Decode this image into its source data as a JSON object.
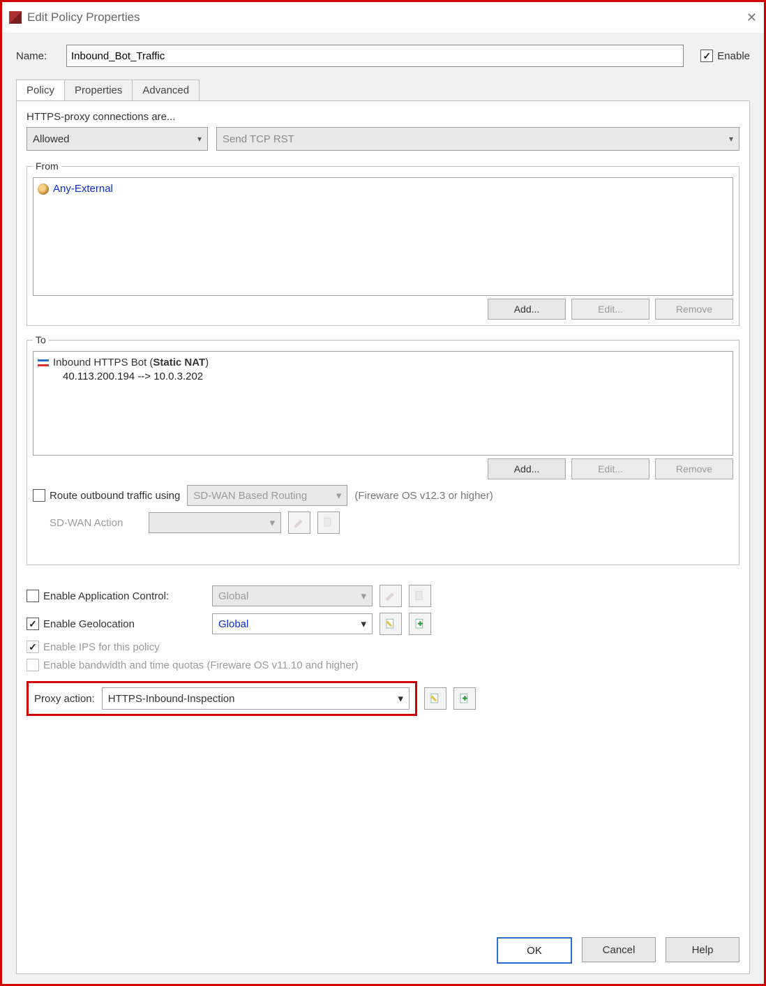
{
  "window": {
    "title": "Edit Policy Properties"
  },
  "name": {
    "label": "Name:",
    "value": "Inbound_Bot_Traffic"
  },
  "enable": {
    "label": "Enable",
    "checked": true
  },
  "tabs": {
    "policy": "Policy",
    "properties": "Properties",
    "advanced": "Advanced",
    "active": "policy"
  },
  "policy": {
    "connections_label": "HTTPS-proxy connections are...",
    "mode": "Allowed",
    "deny_action": "Send TCP RST",
    "from": {
      "legend": "From",
      "items": [
        {
          "text": "Any-External",
          "link": true
        }
      ],
      "add": "Add...",
      "edit": "Edit...",
      "remove": "Remove"
    },
    "to": {
      "legend": "To",
      "items": [
        {
          "text_prefix": "Inbound HTTPS Bot (",
          "text_bold": "Static NAT",
          "text_suffix": ")",
          "sub": "40.113.200.194 --> 10.0.3.202",
          "nat": true
        }
      ],
      "add": "Add...",
      "edit": "Edit...",
      "remove": "Remove",
      "route_outbound_label": "Route outbound traffic using",
      "route_outbound_checked": false,
      "routing_mode": "SD-WAN Based Routing",
      "routing_note": "(Fireware OS v12.3 or higher)",
      "sdwan_label": "SD-WAN Action"
    },
    "app_control": {
      "label": "Enable Application Control:",
      "checked": false,
      "value": "Global"
    },
    "geo": {
      "label": "Enable Geolocation",
      "checked": true,
      "value": "Global"
    },
    "ips": {
      "label": "Enable IPS for this policy",
      "checked": true,
      "disabled": true
    },
    "quotas": {
      "label": "Enable bandwidth and time quotas (Fireware OS v11.10 and higher)",
      "checked": false,
      "disabled": true
    },
    "proxy": {
      "label": "Proxy action:",
      "value": "HTTPS-Inbound-Inspection"
    }
  },
  "footer": {
    "ok": "OK",
    "cancel": "Cancel",
    "help": "Help"
  }
}
